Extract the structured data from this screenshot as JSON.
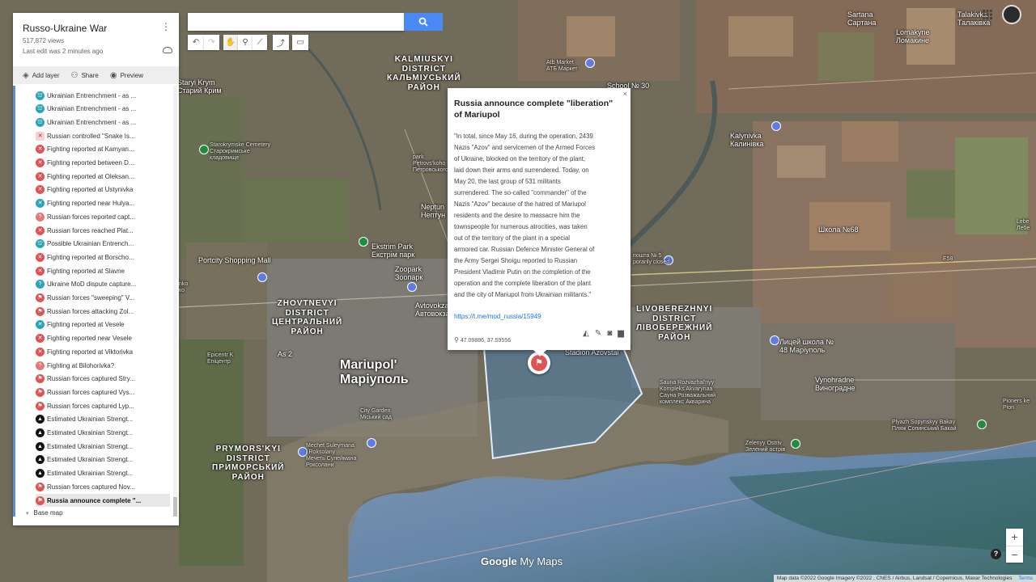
{
  "map": {
    "labels": [
      {
        "id": "kalmiuskyi",
        "text": "KALMIUSKYI\nDISTRICT\nКАЛЬМІУСЬКИЙ\nРАЙОН",
        "cls": "district"
      },
      {
        "id": "zhovtnevyi",
        "text": "ZHOVTNEVYI\nDISTRICT\nЦЕНТРАЛЬНИЙ\nРАЙОН",
        "cls": "district"
      },
      {
        "id": "livoberezhnyi",
        "text": "LIVOBEREZHNYI\nDISTRICT\nЛІВОБЕРЕЖНИЙ\nРАЙОН",
        "cls": "district"
      },
      {
        "id": "prymorskyi",
        "text": "PRYMORS'KYI\nDISTRICT\nПРИМОРСЬКИЙ\nРАЙОН",
        "cls": "district"
      },
      {
        "id": "mariupol",
        "text": "Mariupol'\nМаріуполь",
        "cls": "big"
      },
      {
        "id": "kalynivka",
        "text": "Kalynivka\nКалинівка",
        "cls": "small"
      },
      {
        "id": "vynohradne",
        "text": "Vynohradne\nВиноградне",
        "cls": "small"
      },
      {
        "id": "sartana",
        "text": "Sartana\nСартана",
        "cls": "small"
      },
      {
        "id": "talakivka",
        "text": "Talakivka\nТалаківка",
        "cls": "small"
      },
      {
        "id": "lomakyne",
        "text": "Lomakyne\nЛомакине",
        "cls": "small"
      },
      {
        "id": "stadium",
        "text": "Stadion Azovstal",
        "cls": "small"
      },
      {
        "id": "sauna",
        "text": "Sauna Rozvazhal'nyy\nKompleks Akvarynaa\nСауна Розважальний\nкомплекс Акварина",
        "cls": "tiny"
      },
      {
        "id": "pioners",
        "text": "Pioners ke\nPion",
        "cls": "tiny"
      },
      {
        "id": "plyazh",
        "text": "Plyazh Sopynskyy Bakay\nПляж Сопинський Бакай",
        "cls": "tiny"
      },
      {
        "id": "zelenyy",
        "text": "Zelenyy Ostriv\nЗелений острів",
        "cls": "tiny"
      },
      {
        "id": "liceum",
        "text": "Лицей школа №\n48 Маріуполь",
        "cls": "small"
      },
      {
        "id": "shkola68",
        "text": "Школа №68",
        "cls": "small"
      },
      {
        "id": "atbmarket",
        "text": "Atb Market\nАТБ Маркет",
        "cls": "tiny"
      },
      {
        "id": "school30",
        "text": "School № 30",
        "cls": "small"
      },
      {
        "id": "staryikrym",
        "text": "Staryi Krym\nСтарий Крим",
        "cls": "small"
      },
      {
        "id": "cemetery",
        "text": "Starokrymske Cemetery\nСтарокримське\nкладовище",
        "cls": "tiny"
      },
      {
        "id": "portcity",
        "text": "Portcity Shopping Mall",
        "cls": "small"
      },
      {
        "id": "ekstrim",
        "text": "Ekstrim Park\nЕкстрім парк",
        "cls": "small"
      },
      {
        "id": "zoopark",
        "text": "Zoopark\nЗоопарк",
        "cls": "small"
      },
      {
        "id": "avtovokzal",
        "text": "Avtovokzal\nАвтовокзал",
        "cls": "small"
      },
      {
        "id": "neptun",
        "text": "Neptun\nНептун",
        "cls": "small"
      },
      {
        "id": "epicentr",
        "text": "Epicentr K\nЕпіцентр",
        "cls": "tiny"
      },
      {
        "id": "citygarden",
        "text": "City Garden\nМіський сад",
        "cls": "tiny"
      },
      {
        "id": "mechet",
        "text": "Mechet Suleymana\ni Roksolany\nМечеть Сулеймана\nРоксолани",
        "cls": "tiny"
      },
      {
        "id": "as2",
        "text": "As 2",
        "cls": "small"
      },
      {
        "id": "parkpetr",
        "text": "park\nPetrovs'koho\nПетровського",
        "cls": "tiny"
      },
      {
        "id": "lebed",
        "text": "Lebe\nЛебе",
        "cls": "tiny"
      },
      {
        "id": "pushta",
        "text": "пошта № 5\nporarily closed",
        "cls": "tiny"
      },
      {
        "id": "e58",
        "text": "E58",
        "cls": "tiny"
      },
      {
        "id": "tsko",
        "text": "nko\nко",
        "cls": "tiny"
      }
    ]
  },
  "panel": {
    "title": "Russo-Ukraine War",
    "views": "517,872 views",
    "last_edit": "Last edit was 2 minutes ago",
    "add_layer": "Add layer",
    "share": "Share",
    "preview": "Preview",
    "base_map": "Base map",
    "items": [
      {
        "label": "Ukrainian Entrenchment - as ...",
        "icon": "blue",
        "glyph": "⛫"
      },
      {
        "label": "Ukrainian Entrenchment - as ...",
        "icon": "blue",
        "glyph": "⛫"
      },
      {
        "label": "Ukrainian Entrenchment - as ...",
        "icon": "blue",
        "glyph": "⛫"
      },
      {
        "label": "Russian controlled \"Snake Is...",
        "icon": "snake",
        "glyph": "✕"
      },
      {
        "label": "Fighting reported at Kamyan...",
        "icon": "red",
        "glyph": "✕"
      },
      {
        "label": "Fighting reported between D...",
        "icon": "red",
        "glyph": "✕"
      },
      {
        "label": "Fighting reported at Oleksan...",
        "icon": "red",
        "glyph": "✕"
      },
      {
        "label": "Fighting reported at Ustynivka",
        "icon": "red",
        "glyph": "✕"
      },
      {
        "label": "Fighting reported near Hulya...",
        "icon": "blue",
        "glyph": "✕"
      },
      {
        "label": "Russian forces reported capt...",
        "icon": "pink",
        "glyph": "?"
      },
      {
        "label": "Russian forces reached Plat...",
        "icon": "red",
        "glyph": "✕"
      },
      {
        "label": "Possible Ukrainian Entrench...",
        "icon": "blue",
        "glyph": "⛫"
      },
      {
        "label": "Fighting reported at Borscho...",
        "icon": "red",
        "glyph": "✕"
      },
      {
        "label": "Fighting reported at Slavne",
        "icon": "red",
        "glyph": "✕"
      },
      {
        "label": "Ukraine MoD dispute capture...",
        "icon": "blue",
        "glyph": "?"
      },
      {
        "label": "Russian forces \"sweeping\" V...",
        "icon": "red",
        "glyph": "⚑"
      },
      {
        "label": "Russian forces attacking Zol...",
        "icon": "red",
        "glyph": "⚑"
      },
      {
        "label": "Fighting reported at Vesele",
        "icon": "blue",
        "glyph": "✕"
      },
      {
        "label": "Fighting reported near Vesele",
        "icon": "red",
        "glyph": "✕"
      },
      {
        "label": "Fighting reported at Viktorivka",
        "icon": "red",
        "glyph": "✕"
      },
      {
        "label": "Fighting at Bilohorivka?",
        "icon": "pink",
        "glyph": "?"
      },
      {
        "label": "Russian forces captured Stry...",
        "icon": "red",
        "glyph": "⚑"
      },
      {
        "label": "Russian forces captured Vys...",
        "icon": "red",
        "glyph": "⚑"
      },
      {
        "label": "Russian forces captured Lyp...",
        "icon": "red",
        "glyph": "⚑"
      },
      {
        "label": "Estimated Ukrainian Strengt...",
        "icon": "black",
        "glyph": "▲"
      },
      {
        "label": "Estimated Ukrainian Strengt...",
        "icon": "black",
        "glyph": "▲"
      },
      {
        "label": "Estimated Ukrainian Strengt...",
        "icon": "black",
        "glyph": "▲"
      },
      {
        "label": "Estimated Ukrainian Strengt...",
        "icon": "black",
        "glyph": "▲"
      },
      {
        "label": "Estimated Ukrainian Strengt...",
        "icon": "black",
        "glyph": "▲"
      },
      {
        "label": "Russian forces captured Nov...",
        "icon": "red",
        "glyph": "⚑"
      },
      {
        "label": "Russia announce complete \"...",
        "icon": "red",
        "glyph": "⚑",
        "selected": true
      }
    ]
  },
  "popup": {
    "title": "Russia announce complete \"liberation\" of Mariupol",
    "body_lines": [
      "\"In total, since May 16, during the operation, 2439",
      "Nazis \"Azov\" and servicemen of the Armed Forces",
      "of Ukraine, blocked on the territory of the plant,",
      "laid down their arms and surrendered. Today, on",
      "May 20, the last group of 531 militants",
      "surrendered. The so-called \"commander\" of the",
      "Nazis \"Azov\" because of the hatred of Mariupol",
      "residents and the desire to massacre him the",
      "townspeople for numerous atrocities, was taken",
      "out of the territory of the plant in a special",
      "armored car. Russian Defence Minister General of",
      "the Army Sergei Shoigu reported to Russian",
      "President Vladimir Putin on the completion of the",
      "operation and the complete liberation of the plant",
      "and the city of Mariupol from Ukrainian militants.\""
    ],
    "link": "https://t.me/mod_russia/15949",
    "coords": "47.09886, 37.59556",
    "close": "×"
  },
  "logo": {
    "google": "Google",
    "mymaps": "My Maps"
  },
  "attribution": "Map data ©2022 Google Imagery ©2022 , CNES / Airbus, Landsat / Copernicus, Maxar Technologies",
  "terms": "Terms",
  "zoom": {
    "in": "+",
    "out": "−"
  },
  "help": "?",
  "colors": {
    "land": "#6f6a5a",
    "sea": "#5f82a6",
    "polygon_fill": "#4a7fae",
    "polygon_stroke": "#dfeefa",
    "flag_marker": "#e05353",
    "list_accent": "#5b8ad6",
    "search_button": "#4a8af4"
  }
}
